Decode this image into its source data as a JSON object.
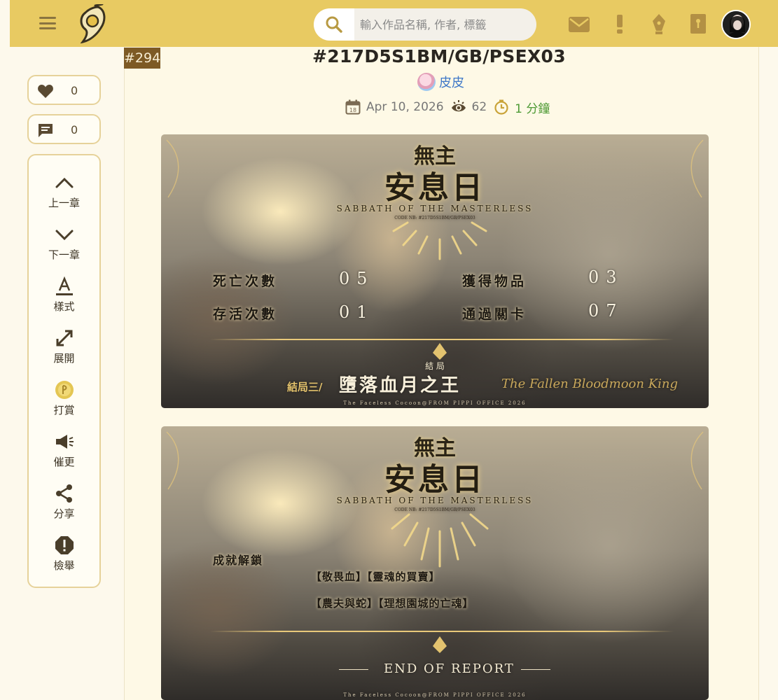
{
  "header": {
    "search_placeholder": "輸入作品名稱, 作者, 標籤"
  },
  "sidebar": {
    "like_count": "0",
    "comment_count": "0",
    "tools": [
      {
        "label": "上一章",
        "icon": "chevron-up-icon"
      },
      {
        "label": "下一章",
        "icon": "chevron-down-icon"
      },
      {
        "label": "樣式",
        "icon": "text-style-icon"
      },
      {
        "label": "展開",
        "icon": "expand-icon"
      },
      {
        "label": "打賞",
        "icon": "coin-icon"
      },
      {
        "label": "催更",
        "icon": "megaphone-icon"
      },
      {
        "label": "分享",
        "icon": "share-icon"
      },
      {
        "label": "檢舉",
        "icon": "report-icon"
      }
    ]
  },
  "article": {
    "badge": "#294",
    "title": "#217D5S1BM/GB/PSEX03",
    "author": "皮皮",
    "date": "Apr 10, 2026",
    "views": "62",
    "read_time": "1 分鐘"
  },
  "banner1": {
    "logo_top": "無主",
    "logo_main": "安息日",
    "subtitle": "SABBATH OF THE MASTERLESS",
    "code": "CODE NB: #217D5S1BM/GB/PSEX03",
    "stats": [
      {
        "label": "死亡次數",
        "value": "05"
      },
      {
        "label": "獲得物品",
        "value": "03"
      },
      {
        "label": "存活次數",
        "value": "01"
      },
      {
        "label": "通過關卡",
        "value": "07"
      }
    ],
    "ending_small": "結 局",
    "ending_prefix": "結局三/",
    "ending_title": "墮落血月之王",
    "ending_en": "The Fallen Bloodmoon King",
    "footer": "The Faceless Cocoon@FROM PIPPI OFFICE 2026"
  },
  "banner2": {
    "logo_top": "無主",
    "logo_main": "安息日",
    "subtitle": "SABBATH OF THE MASTERLESS",
    "code": "CODE NB: #217D5S1BM/GB/PSEX03",
    "achievement_label": "成就解鎖",
    "achievement_line1": "【敬畏血】【靈魂的買賣】",
    "achievement_line2": "【農夫與蛇】【理想園城的亡魂】",
    "end_report": "END OF REPORT",
    "footer": "The Faceless Cocoon@FROM PIPPI OFFICE 2026"
  },
  "colors": {
    "topbar": "#e8ca62",
    "accent_brown": "#7d5a25",
    "author_blue": "#3f78c8",
    "read_green": "#4d9a34",
    "background": "#fdf9ec"
  }
}
